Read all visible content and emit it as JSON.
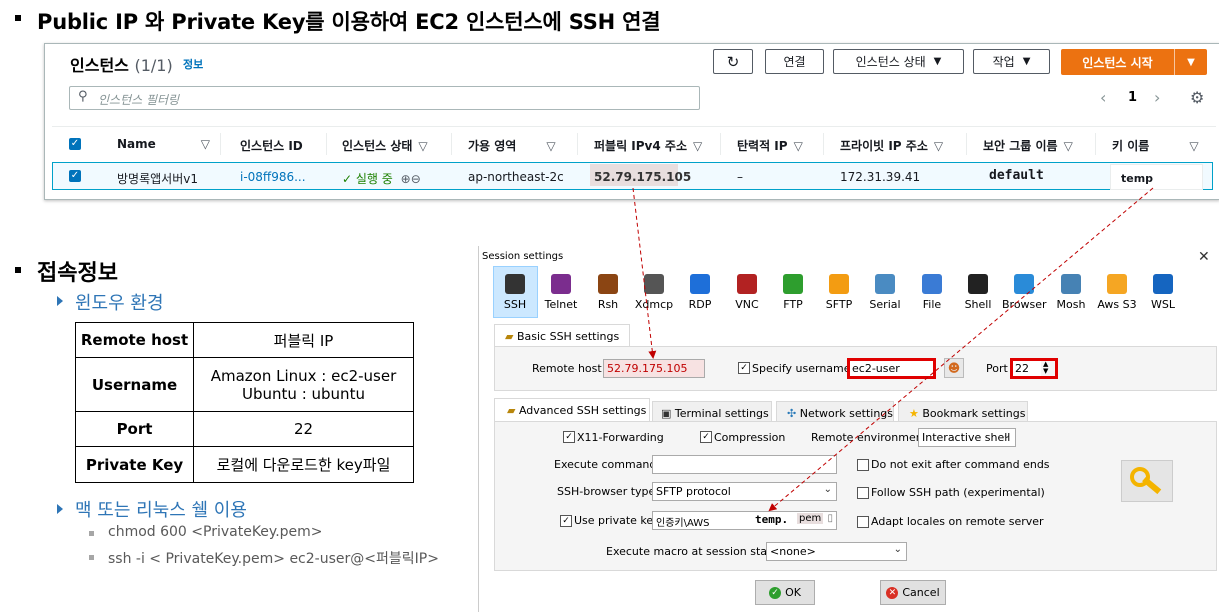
{
  "slide": {
    "title": "Public IP 와 Private Key를 이용하여 EC2 인스턴스에 SSH 연결",
    "section2": "접속정보",
    "sub_windows": "윈도우 환경",
    "sub_mac": "맥 또는 리눅스 쉘 이용",
    "table": [
      {
        "key": "Remote host",
        "value": "퍼블릭 IP"
      },
      {
        "key": "Username",
        "value": "Amazon Linux : ec2-user\nUbuntu : ubuntu"
      },
      {
        "key": "Port",
        "value": "22"
      },
      {
        "key": "Private Key",
        "value": "로컬에 다운로드한 key파일"
      }
    ],
    "commands": [
      "chmod 600 <PrivateKey.pem>",
      "ssh -i < PrivateKey.pem> ec2-user@<퍼블릭IP>"
    ]
  },
  "aws": {
    "heading": "인스턴스",
    "count": "(1/1)",
    "info_link": "정보",
    "buttons": {
      "refresh": "↻",
      "connect": "연결",
      "state": "인스턴스 상태",
      "actions": "작업",
      "launch": "인스턴스 시작"
    },
    "search_placeholder": "인스턴스 필터링",
    "page": "1",
    "columns": [
      "Name",
      "인스턴스 ID",
      "인스턴스 상태",
      "가용 영역",
      "퍼블릭 IPv4 주소",
      "탄력적 IP",
      "프라이빗 IP 주소",
      "보안 그룹 이름",
      "키 이름"
    ],
    "row": {
      "name": "방명록앱서버v1",
      "instance_id": "i-08ff986...",
      "state": "실행 중",
      "az": "ap-northeast-2c",
      "public_ip": "52.79.175.105",
      "elastic_ip": "–",
      "private_ip": "172.31.39.41",
      "security_group": "default",
      "key_name": "temp"
    }
  },
  "dialog": {
    "title": "Session settings",
    "protocols": [
      {
        "label": "SSH",
        "icon": "ssh-icon",
        "color": "#333333"
      },
      {
        "label": "Telnet",
        "icon": "telnet-icon",
        "color": "#7b2d8e"
      },
      {
        "label": "Rsh",
        "icon": "rsh-icon",
        "color": "#8b4513"
      },
      {
        "label": "Xdmcp",
        "icon": "xdmcp-icon",
        "color": "#555555"
      },
      {
        "label": "RDP",
        "icon": "rdp-icon",
        "color": "#1e6fd9"
      },
      {
        "label": "VNC",
        "icon": "vnc-icon",
        "color": "#b22222"
      },
      {
        "label": "FTP",
        "icon": "ftp-icon",
        "color": "#2e9e2e"
      },
      {
        "label": "SFTP",
        "icon": "sftp-icon",
        "color": "#f39c12"
      },
      {
        "label": "Serial",
        "icon": "serial-icon",
        "color": "#4a8bc2"
      },
      {
        "label": "File",
        "icon": "file-icon",
        "color": "#3a7bd5"
      },
      {
        "label": "Shell",
        "icon": "shell-icon",
        "color": "#222222"
      },
      {
        "label": "Browser",
        "icon": "browser-icon",
        "color": "#2a8bd8"
      },
      {
        "label": "Mosh",
        "icon": "mosh-icon",
        "color": "#4682b4"
      },
      {
        "label": "Aws S3",
        "icon": "aws-s3-icon",
        "color": "#f5a623"
      },
      {
        "label": "WSL",
        "icon": "wsl-icon",
        "color": "#1565c0"
      }
    ],
    "basic_tab": "Basic SSH settings",
    "remote_host_label": "Remote host *",
    "remote_host_value": "52.79.175.105",
    "specify_username_label": "Specify username",
    "username_value": "ec2-user",
    "port_label": "Port",
    "port_value": "22",
    "adv_tabs": [
      "Advanced SSH settings",
      "Terminal settings",
      "Network settings",
      "Bookmark settings"
    ],
    "x11": "X11-Forwarding",
    "compression": "Compression",
    "remote_env_label": "Remote environment:",
    "remote_env_value": "Interactive shell",
    "exec_cmd_label": "Execute command:",
    "no_exit": "Do not exit after command ends",
    "ssh_browser_label": "SSH-browser type:",
    "ssh_browser_value": "SFTP protocol",
    "follow_path": "Follow SSH path (experimental)",
    "use_private_key": "Use private key",
    "key_path": "인증키\\AWS",
    "key_file": "temp.",
    "key_ext": "pem",
    "adapt_locales": "Adapt locales on remote server",
    "macro_label": "Execute macro at session start:",
    "macro_value": "<none>",
    "ok": "OK",
    "cancel": "Cancel"
  }
}
